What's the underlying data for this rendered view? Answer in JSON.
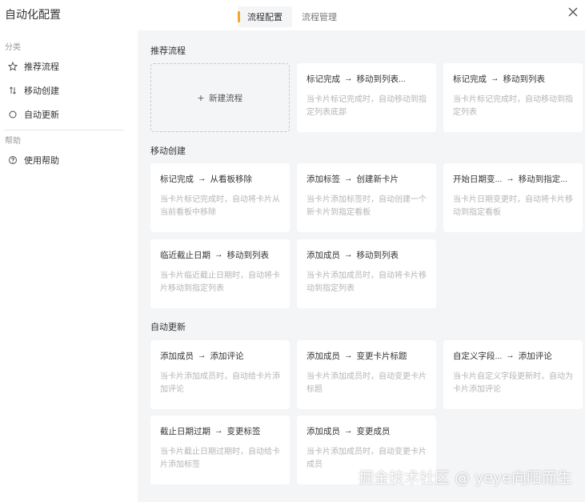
{
  "app": {
    "title": "自动化配置"
  },
  "tabs": [
    {
      "label": "流程配置",
      "active": true
    },
    {
      "label": "流程管理",
      "active": false
    }
  ],
  "sidebar": {
    "category_title": "分类",
    "items": [
      {
        "label": "推荐流程",
        "icon": "star-icon"
      },
      {
        "label": "移动创建",
        "icon": "sort-arrows-icon"
      },
      {
        "label": "自动更新",
        "icon": "circle-icon"
      }
    ],
    "help_title": "帮助",
    "help_items": [
      {
        "label": "使用帮助",
        "icon": "question-circle-icon"
      }
    ]
  },
  "sections": {
    "recommended": {
      "title": "推荐流程",
      "new_label": "新建流程",
      "cards": [
        {
          "from": "标记完成",
          "to": "移动到列表...",
          "desc": "当卡片标记完成时，自动移动到指定列表底部"
        },
        {
          "from": "标记完成",
          "to": "移动到列表",
          "desc": "当卡片标记完成时，自动移动到指定列表"
        }
      ]
    },
    "move_create": {
      "title": "移动创建",
      "cards": [
        {
          "from": "标记完成",
          "to": "从看板移除",
          "desc": "当卡片标记完成时，自动将卡片从当前看板中移除"
        },
        {
          "from": "添加标签",
          "to": "创建新卡片",
          "desc": "当卡片添加标签时，自动创建一个新卡片到指定看板"
        },
        {
          "from": "开始日期变...",
          "to": "移动到指定...",
          "desc": "当卡片日期变更时，自动将卡片移动到指定看板"
        },
        {
          "from": "临近截止日期",
          "to": "移动到列表",
          "desc": "当卡片临近截止日期时，自动将卡片移动到指定列表"
        },
        {
          "from": "添加成员",
          "to": "移动到列表",
          "desc": "当卡片添加成员时，自动将卡片移动到指定列表"
        }
      ]
    },
    "auto_update": {
      "title": "自动更新",
      "cards": [
        {
          "from": "添加成员",
          "to": "添加评论",
          "desc": "当卡片添加成员时，自动给卡片添加评论"
        },
        {
          "from": "添加成员",
          "to": "变更卡片标题",
          "desc": "当卡片添加成员时，自动变更卡片标题"
        },
        {
          "from": "自定义字段...",
          "to": "添加评论",
          "desc": "当卡片自定义字段更新时，自动为卡片添加评论"
        },
        {
          "from": "截止日期过期",
          "to": "变更标签",
          "desc": "当卡片截止日期过期时，自动给卡片添加标签"
        },
        {
          "from": "添加成员",
          "to": "变更成员",
          "desc": "当卡片添加成员时，自动变更卡片成员"
        }
      ]
    }
  },
  "arrow": "→",
  "watermark": "掘金技术社区 @ yeye向阳而生",
  "colors": {
    "accent": "#f5a623",
    "panel_bg": "#f4f5f7",
    "desc_text": "#b5b5b5"
  }
}
